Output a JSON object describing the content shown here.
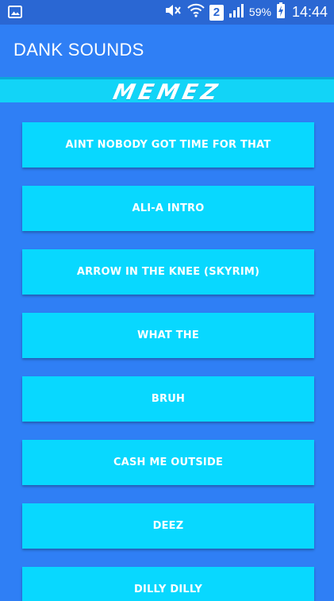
{
  "status_bar": {
    "sim": "2",
    "battery_pct": "59%",
    "time": "14:44"
  },
  "app_bar": {
    "title": "DANK SOUNDS"
  },
  "banner": {
    "text": "MEMEZ"
  },
  "sounds": [
    {
      "label": "AINT NOBODY GOT TIME FOR THAT"
    },
    {
      "label": "ALI-A INTRO"
    },
    {
      "label": "ARROW IN THE KNEE (SKYRIM)"
    },
    {
      "label": "WHAT THE"
    },
    {
      "label": "BRUH"
    },
    {
      "label": "CASH ME OUTSIDE"
    },
    {
      "label": "DEEZ"
    },
    {
      "label": "DILLY DILLY"
    }
  ],
  "colors": {
    "background": "#2f7ff5",
    "status_bar": "#2a67d3",
    "button": "#08d8ff",
    "banner": "#12d4f7",
    "text": "#ffffff"
  },
  "icons": [
    "gallery-notification-icon",
    "mute-icon",
    "wifi-icon",
    "signal-icon",
    "battery-charging-icon"
  ]
}
